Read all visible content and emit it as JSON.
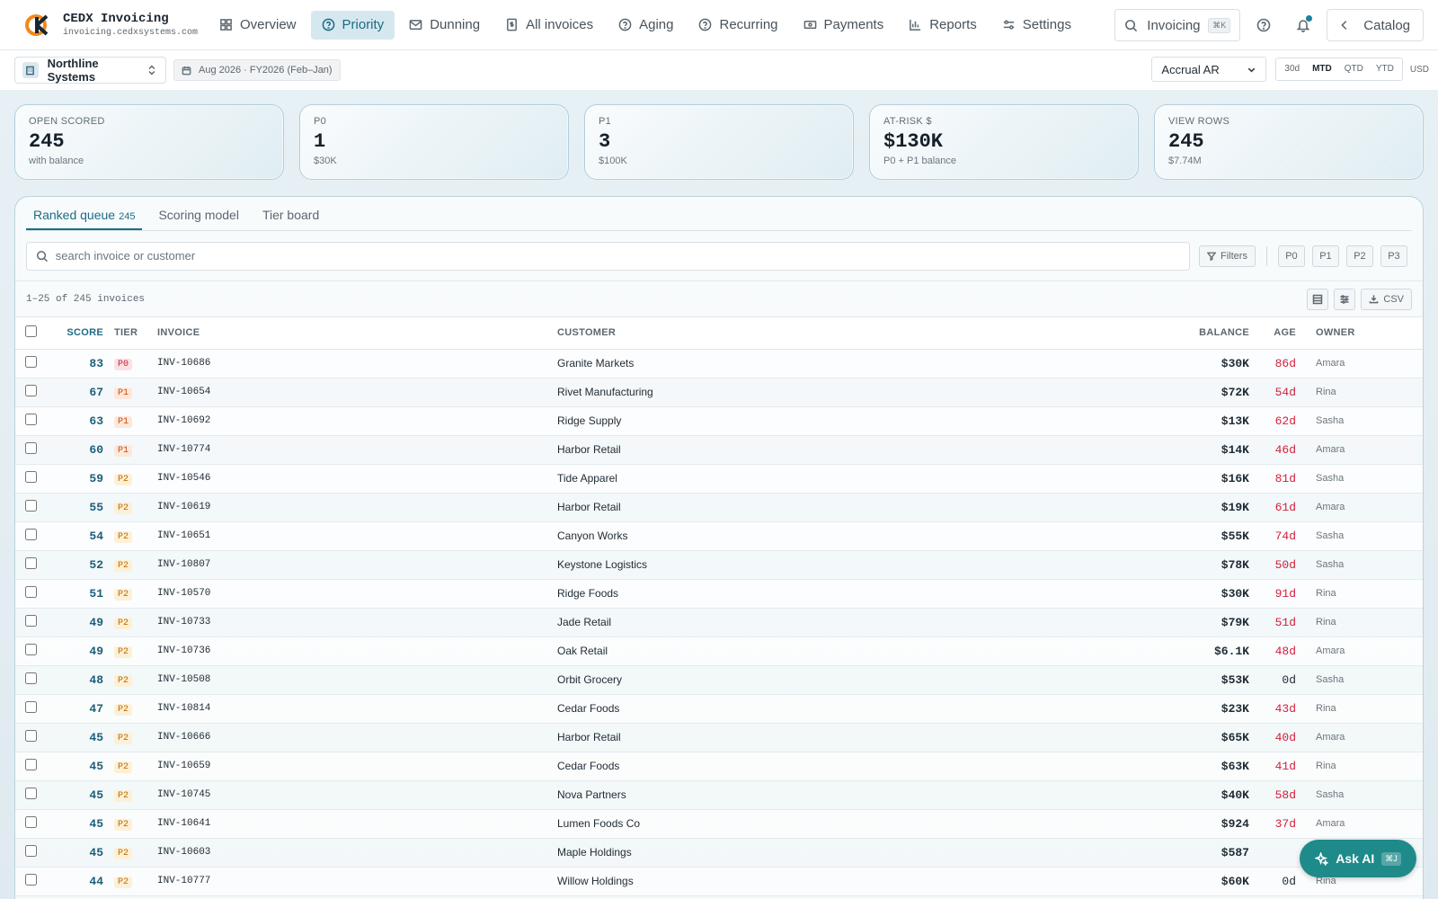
{
  "brand": {
    "name": "CEDX Invoicing",
    "domain": "invoicing.cedxsystems.com"
  },
  "nav": {
    "tabs": [
      {
        "label": "Overview",
        "icon": "grid-icon"
      },
      {
        "label": "Priority",
        "icon": "help-circle-icon",
        "active": true
      },
      {
        "label": "Dunning",
        "icon": "mail-icon"
      },
      {
        "label": "All invoices",
        "icon": "document-dollar-icon"
      },
      {
        "label": "Aging",
        "icon": "help-circle-icon"
      },
      {
        "label": "Recurring",
        "icon": "help-circle-icon"
      },
      {
        "label": "Payments",
        "icon": "banknote-icon"
      },
      {
        "label": "Reports",
        "icon": "bar-chart-icon"
      },
      {
        "label": "Settings",
        "icon": "sliders-icon"
      }
    ],
    "search_label": "Invoicing",
    "search_kbd": "⌘K",
    "catalog_label": "Catalog"
  },
  "subbar": {
    "org": "Northline Systems",
    "period": "Aug 2026 · FY2026 (Feb–Jan)",
    "basis": "Accrual AR",
    "ranges": [
      "30d",
      "MTD",
      "QTD",
      "YTD"
    ],
    "active_range": "MTD",
    "currency": "USD"
  },
  "kpis": [
    {
      "label": "Open scored",
      "value": "245",
      "sub": "with balance"
    },
    {
      "label": "P0",
      "value": "1",
      "sub": "$30K"
    },
    {
      "label": "P1",
      "value": "3",
      "sub": "$100K"
    },
    {
      "label": "At-risk $",
      "value": "$130K",
      "sub": "P0 + P1 balance"
    },
    {
      "label": "View rows",
      "value": "245",
      "sub": "$7.74M"
    }
  ],
  "panel": {
    "tabs": [
      {
        "label": "Ranked queue",
        "count": "245"
      },
      {
        "label": "Scoring model"
      },
      {
        "label": "Tier board"
      }
    ],
    "search_placeholder": "search invoice or customer",
    "filters_label": "Filters",
    "tier_filters": [
      "P0",
      "P1",
      "P2",
      "P3"
    ],
    "meta": "1–25 of 245 invoices",
    "csv_label": "CSV"
  },
  "table": {
    "columns": {
      "score": "SCORE",
      "tier": "TIER",
      "invoice": "INVOICE",
      "customer": "CUSTOMER",
      "balance": "BALANCE",
      "age": "AGE",
      "owner": "OWNER"
    },
    "rows": [
      {
        "score": "83",
        "tier": "P0",
        "invoice": "INV-10686",
        "customer": "Granite Markets",
        "balance": "$30K",
        "age": "86d",
        "owner": "Amara"
      },
      {
        "score": "67",
        "tier": "P1",
        "invoice": "INV-10654",
        "customer": "Rivet Manufacturing",
        "balance": "$72K",
        "age": "54d",
        "owner": "Rina"
      },
      {
        "score": "63",
        "tier": "P1",
        "invoice": "INV-10692",
        "customer": "Ridge Supply",
        "balance": "$13K",
        "age": "62d",
        "owner": "Sasha"
      },
      {
        "score": "60",
        "tier": "P1",
        "invoice": "INV-10774",
        "customer": "Harbor Retail",
        "balance": "$14K",
        "age": "46d",
        "owner": "Amara"
      },
      {
        "score": "59",
        "tier": "P2",
        "invoice": "INV-10546",
        "customer": "Tide Apparel",
        "balance": "$16K",
        "age": "81d",
        "owner": "Sasha"
      },
      {
        "score": "55",
        "tier": "P2",
        "invoice": "INV-10619",
        "customer": "Harbor Retail",
        "balance": "$19K",
        "age": "61d",
        "owner": "Amara"
      },
      {
        "score": "54",
        "tier": "P2",
        "invoice": "INV-10651",
        "customer": "Canyon Works",
        "balance": "$55K",
        "age": "74d",
        "owner": "Sasha"
      },
      {
        "score": "52",
        "tier": "P2",
        "invoice": "INV-10807",
        "customer": "Keystone Logistics",
        "balance": "$78K",
        "age": "50d",
        "owner": "Sasha"
      },
      {
        "score": "51",
        "tier": "P2",
        "invoice": "INV-10570",
        "customer": "Ridge Foods",
        "balance": "$30K",
        "age": "91d",
        "owner": "Rina"
      },
      {
        "score": "49",
        "tier": "P2",
        "invoice": "INV-10733",
        "customer": "Jade Retail",
        "balance": "$79K",
        "age": "51d",
        "owner": "Rina"
      },
      {
        "score": "49",
        "tier": "P2",
        "invoice": "INV-10736",
        "customer": "Oak Retail",
        "balance": "$6.1K",
        "age": "48d",
        "owner": "Amara"
      },
      {
        "score": "48",
        "tier": "P2",
        "invoice": "INV-10508",
        "customer": "Orbit Grocery",
        "balance": "$53K",
        "age": "0d",
        "owner": "Sasha"
      },
      {
        "score": "47",
        "tier": "P2",
        "invoice": "INV-10814",
        "customer": "Cedar Foods",
        "balance": "$23K",
        "age": "43d",
        "owner": "Rina"
      },
      {
        "score": "45",
        "tier": "P2",
        "invoice": "INV-10666",
        "customer": "Harbor Retail",
        "balance": "$65K",
        "age": "40d",
        "owner": "Amara"
      },
      {
        "score": "45",
        "tier": "P2",
        "invoice": "INV-10659",
        "customer": "Cedar Foods",
        "balance": "$63K",
        "age": "41d",
        "owner": "Rina"
      },
      {
        "score": "45",
        "tier": "P2",
        "invoice": "INV-10745",
        "customer": "Nova Partners",
        "balance": "$40K",
        "age": "58d",
        "owner": "Sasha"
      },
      {
        "score": "45",
        "tier": "P2",
        "invoice": "INV-10641",
        "customer": "Lumen Foods Co",
        "balance": "$924",
        "age": "37d",
        "owner": "Amara"
      },
      {
        "score": "45",
        "tier": "P2",
        "invoice": "INV-10603",
        "customer": "Maple Holdings",
        "balance": "$587",
        "age": "",
        "owner": ""
      },
      {
        "score": "44",
        "tier": "P2",
        "invoice": "INV-10777",
        "customer": "Willow Holdings",
        "balance": "$60K",
        "age": "0d",
        "owner": "Rina"
      }
    ]
  },
  "ask_ai": {
    "label": "Ask AI",
    "kbd": "⌘J"
  }
}
